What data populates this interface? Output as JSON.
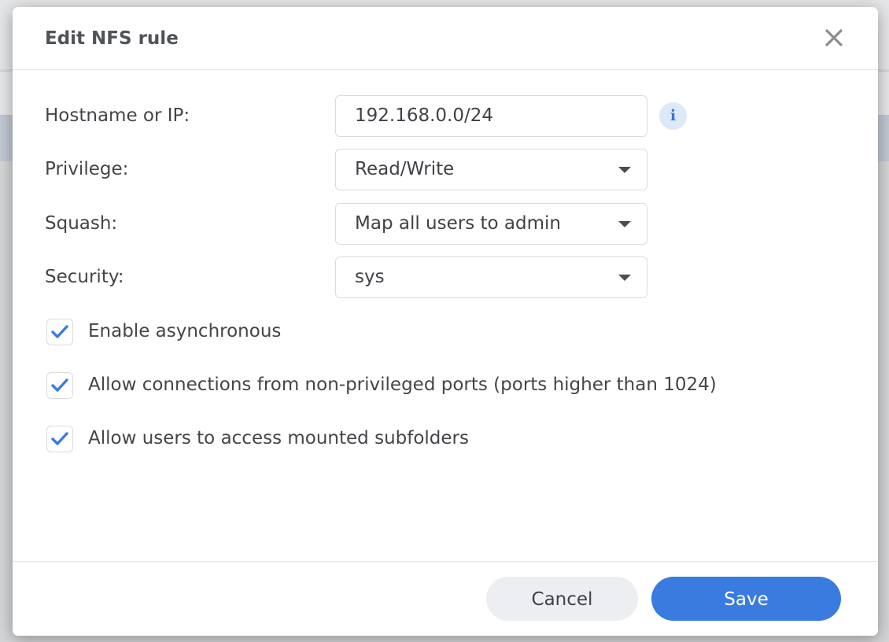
{
  "dialog": {
    "title": "Edit NFS rule",
    "close_icon": "close-icon"
  },
  "form": {
    "hostname": {
      "label": "Hostname or IP:",
      "value": "192.168.0.0/24",
      "info_icon": "info-icon",
      "info_glyph": "i"
    },
    "privilege": {
      "label": "Privilege:",
      "selected": "Read/Write"
    },
    "squash": {
      "label": "Squash:",
      "selected": "Map all users to admin"
    },
    "security": {
      "label": "Security:",
      "selected": "sys"
    },
    "checkboxes": [
      {
        "label": "Enable asynchronous",
        "checked": true
      },
      {
        "label": "Allow connections from non-privileged ports (ports higher than 1024)",
        "checked": true
      },
      {
        "label": "Allow users to access mounted subfolders",
        "checked": true
      }
    ]
  },
  "footer": {
    "cancel_label": "Cancel",
    "save_label": "Save"
  },
  "colors": {
    "accent": "#3a7be0",
    "check": "#3a7be0",
    "info_bg": "#dde9f8"
  }
}
